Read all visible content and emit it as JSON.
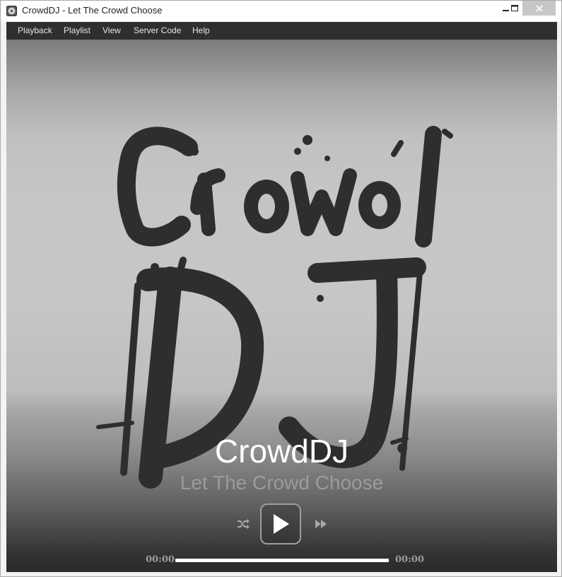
{
  "window": {
    "title": "CrowdDJ - Let The Crowd Choose",
    "controls": [
      "minimize",
      "maximize",
      "close"
    ]
  },
  "menu": {
    "items": [
      {
        "label": "Playback"
      },
      {
        "label": "Playlist"
      },
      {
        "label": "View"
      },
      {
        "label": "Server Code"
      },
      {
        "label": "Help"
      }
    ]
  },
  "logo": {
    "line1": "Crowd",
    "line2": "DJ"
  },
  "now_playing": {
    "title": "CrowdDJ",
    "subtitle": "Let The Crowd Choose"
  },
  "player": {
    "elapsed": "00:00",
    "total": "00:00",
    "progress": 0,
    "icons": {
      "shuffle": "shuffle-icon",
      "play": "play-icon",
      "next": "fast-forward-icon"
    }
  },
  "colors": {
    "menubar": "#2f2f2f",
    "logo_ink": "#2e2e2e",
    "close_button": "#c7c7c7"
  }
}
